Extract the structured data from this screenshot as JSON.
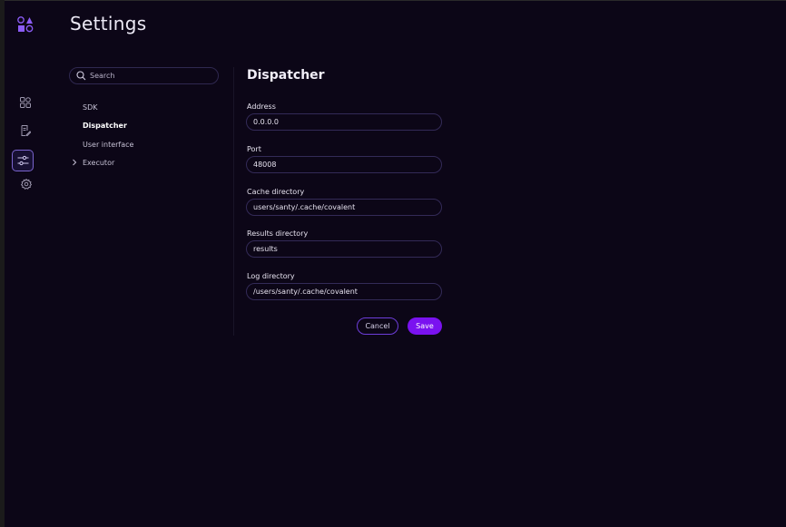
{
  "app": {
    "logo": "covalent-logo"
  },
  "colors": {
    "background": "#0c0617",
    "accent": "#7a12f0",
    "border": "#332a57"
  },
  "rail": {
    "items": [
      {
        "icon": "grid-icon",
        "active": false
      },
      {
        "icon": "document-edit-icon",
        "active": false
      },
      {
        "icon": "sliders-icon",
        "active": true
      },
      {
        "icon": "gear-icon",
        "active": false
      }
    ]
  },
  "header": {
    "title": "Settings"
  },
  "sidebar": {
    "search_placeholder": "Search",
    "items": [
      {
        "label": "SDK",
        "active": false
      },
      {
        "label": "Dispatcher",
        "active": true
      },
      {
        "label": "User interface",
        "active": false
      },
      {
        "label": "Executor",
        "active": false,
        "expandable": true
      }
    ]
  },
  "main": {
    "title": "Dispatcher",
    "fields": [
      {
        "label": "Address",
        "value": "0.0.0.0"
      },
      {
        "label": "Port",
        "value": "48008"
      },
      {
        "label": "Cache directory",
        "value": "users/santy/.cache/covalent"
      },
      {
        "label": "Results directory",
        "value": "results"
      },
      {
        "label": "Log directory",
        "value": "/users/santy/.cache/covalent"
      }
    ],
    "cancel_label": "Cancel",
    "save_label": "Save"
  }
}
